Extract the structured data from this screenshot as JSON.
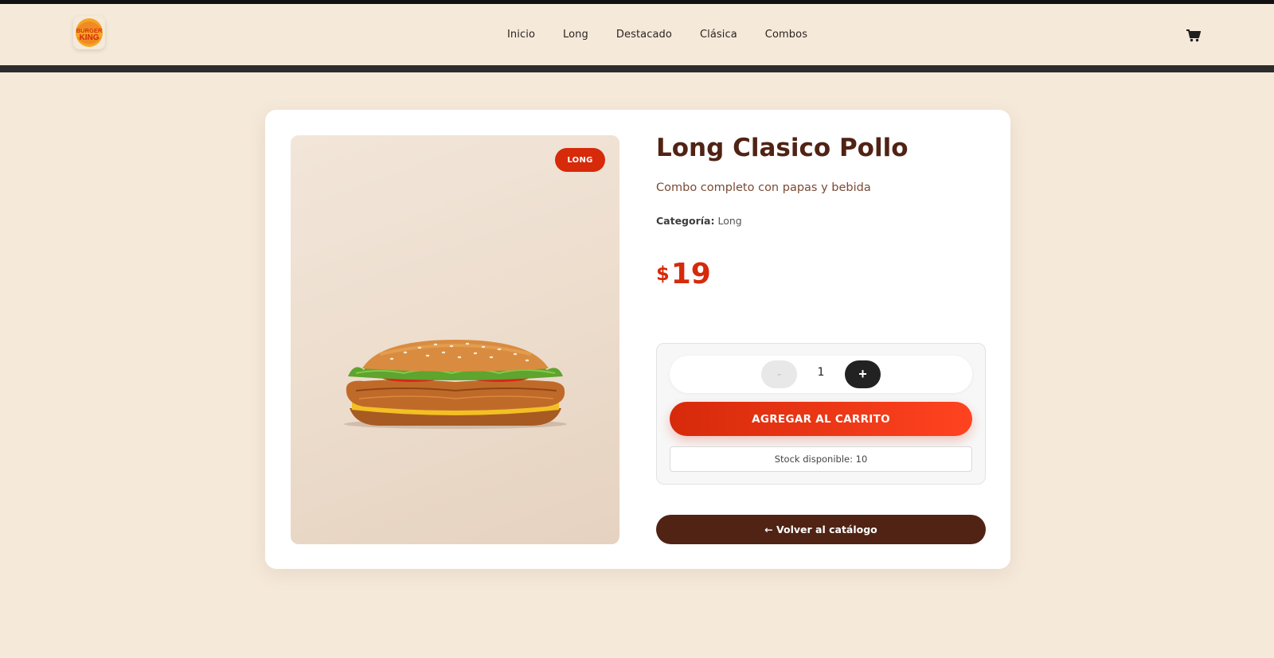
{
  "brand": {
    "logo_text": [
      "BURGER",
      "KING"
    ],
    "colors": {
      "primary": "#d62a0b",
      "brown": "#502314",
      "background": "#f5e9da"
    }
  },
  "nav": {
    "links": [
      "Inicio",
      "Long",
      "Destacado",
      "Clásica",
      "Combos"
    ],
    "cart_icon": "cart-icon"
  },
  "product": {
    "badge": "LONG",
    "title": "Long Clasico Pollo",
    "description": "Combo completo con papas y bebida",
    "category_label": "Categoría:",
    "category_value": "Long",
    "currency": "$",
    "price": "19",
    "image_icon": "chicken-sandwich-image"
  },
  "purchase": {
    "minus_label": "-",
    "quantity": "1",
    "plus_label": "+",
    "add_to_cart": "AGREGAR AL CARRITO",
    "stock": "Stock disponible: 10"
  },
  "back_button": "← Volver al catálogo"
}
